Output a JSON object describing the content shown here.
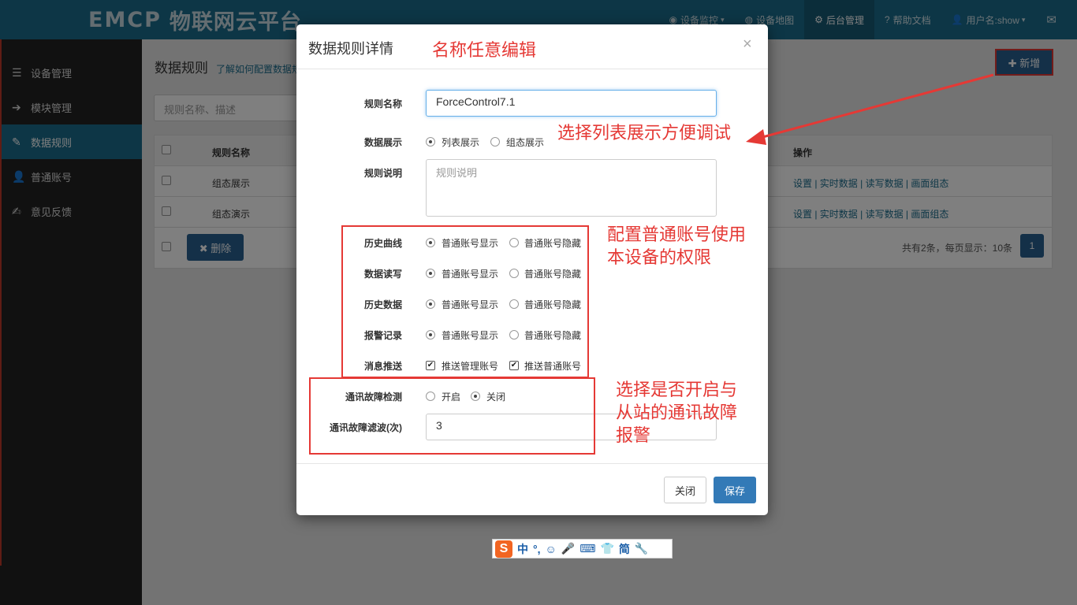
{
  "topbar": {
    "logo_brand": "EMCP",
    "logo_text": "物联网云平台",
    "nav": [
      {
        "icon": "◉",
        "label": "设备监控",
        "caret": "▾"
      },
      {
        "icon": "◍",
        "label": "设备地图"
      },
      {
        "icon": "⚙",
        "label": "后台管理"
      },
      {
        "icon": "?",
        "label": "帮助文档"
      },
      {
        "icon": "👤",
        "label": "用户名:show",
        "caret": "▾"
      },
      {
        "icon": "✉",
        "label": ""
      }
    ]
  },
  "sidebar": {
    "items": [
      {
        "icon": "☰",
        "label": "设备管理"
      },
      {
        "icon": "➔",
        "label": "模块管理"
      },
      {
        "icon": "✎",
        "label": "数据规则"
      },
      {
        "icon": "👤",
        "label": "普通账号"
      },
      {
        "icon": "✍",
        "label": "意见反馈"
      }
    ]
  },
  "main": {
    "title": "数据规则",
    "help_link": "了解如何配置数据规则",
    "add_label": "✚ 新增",
    "search_placeholder": "规则名称、描述",
    "table": {
      "headers": [
        "规则名称",
        "操作"
      ],
      "rows": [
        {
          "name": "组态展示",
          "ops": "设置 | 实时数据 | 读写数据 | 画面组态"
        },
        {
          "name": "组态演示",
          "ops": "设置 | 实时数据 | 读写数据 | 画面组态"
        }
      ]
    },
    "delete_label": "✖ 删除",
    "pager_text": "共有2条，每页显示：10条",
    "pager_page": "1"
  },
  "modal": {
    "title": "数据规则详情",
    "close_glyph": "×",
    "name_label": "规则名称",
    "name_value": "ForceControl7.1",
    "display_label": "数据展示",
    "display_options": [
      "列表展示",
      "组态展示"
    ],
    "desc_label": "规则说明",
    "desc_placeholder": "规则说明",
    "perm_rows": [
      {
        "label": "历史曲线",
        "opt_a": "普通账号显示",
        "opt_b": "普通账号隐藏"
      },
      {
        "label": "数据读写",
        "opt_a": "普通账号显示",
        "opt_b": "普通账号隐藏"
      },
      {
        "label": "历史数据",
        "opt_a": "普通账号显示",
        "opt_b": "普通账号隐藏"
      },
      {
        "label": "报警记录",
        "opt_a": "普通账号显示",
        "opt_b": "普通账号隐藏"
      }
    ],
    "push_label": "消息推送",
    "push_options": [
      "推送管理账号",
      "推送普通账号"
    ],
    "fault_label": "通讯故障检测",
    "fault_options": [
      "开启",
      "关闭"
    ],
    "filter_label": "通讯故障滤波(次)",
    "filter_value": "3",
    "btn_close": "关闭",
    "btn_save": "保存"
  },
  "annotations": {
    "a1": "名称任意编辑",
    "a2": "选择列表展示方便调试",
    "a3_l1": "配置普通账号使用",
    "a3_l2": "本设备的权限",
    "a4_l1": "选择是否开启与",
    "a4_l2": "从站的通讯故障",
    "a4_l3": "报警"
  },
  "ime": {
    "logo": "S",
    "items": [
      "中",
      "°,",
      "☺",
      "🎤",
      "⌨",
      "👕",
      "简",
      "🔧"
    ]
  },
  "colors": {
    "topbar": "#1b6d8d",
    "sidebar": "#222222",
    "primary": "#286090",
    "annotation": "#e53935"
  }
}
